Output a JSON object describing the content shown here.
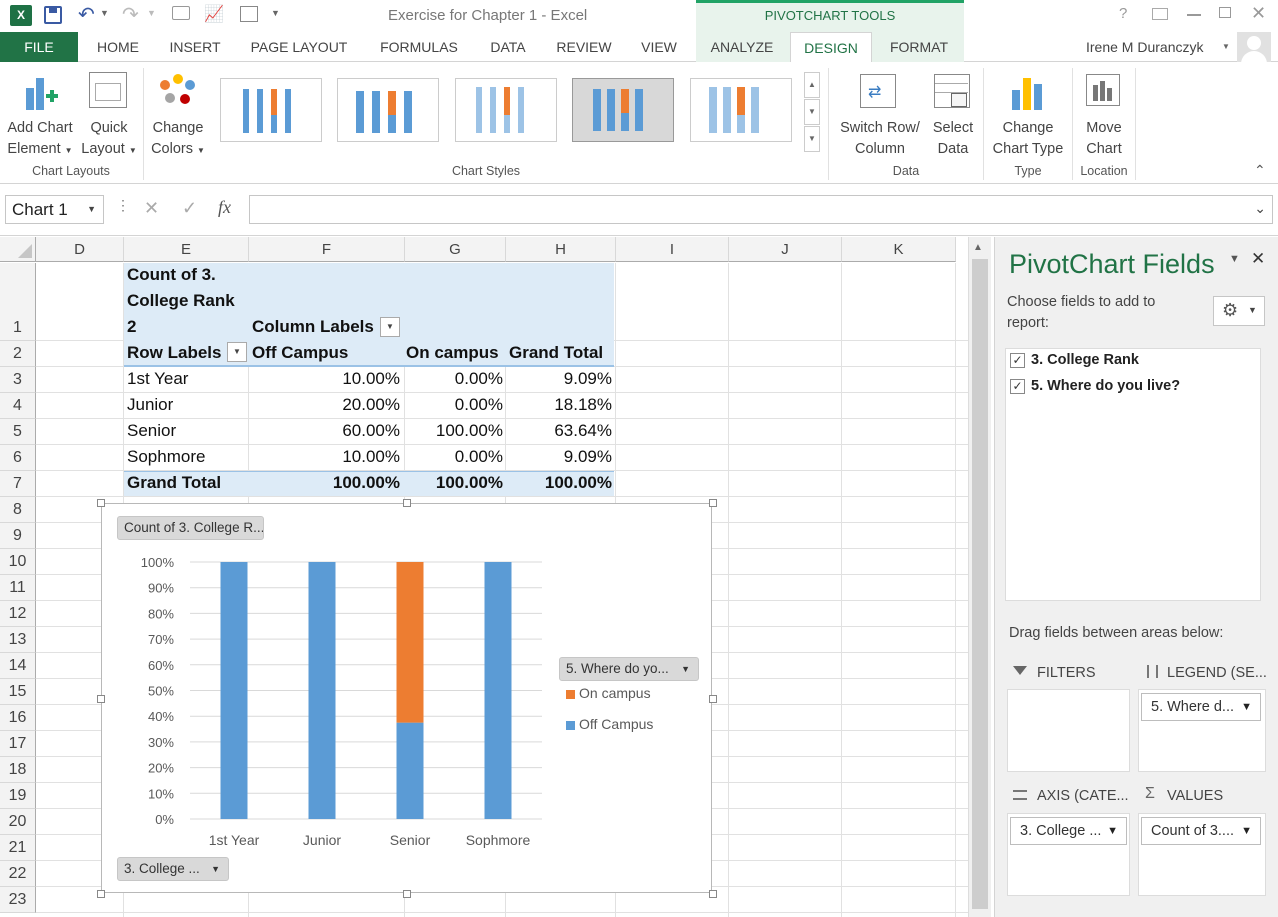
{
  "window": {
    "title": "Exercise for Chapter 1 - Excel",
    "context_tab_group": "PIVOTCHART TOOLS",
    "user": "Irene M Duranczyk",
    "help": "?"
  },
  "ribbon_tabs": [
    "FILE",
    "HOME",
    "INSERT",
    "PAGE LAYOUT",
    "FORMULAS",
    "DATA",
    "REVIEW",
    "VIEW",
    "ANALYZE",
    "DESIGN",
    "FORMAT"
  ],
  "active_tab": "DESIGN",
  "ribbon": {
    "add_chart_element": [
      "Add Chart",
      "Element"
    ],
    "quick_layout": [
      "Quick",
      "Layout"
    ],
    "group_chart_layouts": "Chart Layouts",
    "change_colors": [
      "Change",
      "Colors"
    ],
    "group_chart_styles": "Chart Styles",
    "switch_row_column": [
      "Switch Row/",
      "Column"
    ],
    "select_data": [
      "Select",
      "Data"
    ],
    "group_data": "Data",
    "change_chart_type": [
      "Change",
      "Chart Type"
    ],
    "group_type": "Type",
    "move_chart": [
      "Move",
      "Chart"
    ],
    "group_location": "Location"
  },
  "formula_bar": {
    "name_box": "Chart 1",
    "fx": "fx",
    "formula": ""
  },
  "sheet": {
    "columns": [
      "D",
      "E",
      "F",
      "G",
      "H",
      "I",
      "J",
      "K"
    ],
    "rows": [
      "1",
      "2",
      "3",
      "4",
      "5",
      "6",
      "7",
      "8",
      "9",
      "10",
      "11",
      "12",
      "13",
      "14",
      "15",
      "16",
      "17",
      "18",
      "19",
      "20",
      "21",
      "22",
      "23"
    ],
    "pivot_title": [
      "Count of 3.",
      "College Rank",
      "2"
    ],
    "column_labels": "Column Labels",
    "row_labels": "Row Labels",
    "headers": [
      "Off Campus",
      "On campus",
      "Grand Total"
    ],
    "data_rows": [
      {
        "label": "1st Year",
        "values": [
          "10.00%",
          "0.00%",
          "9.09%"
        ]
      },
      {
        "label": "Junior",
        "values": [
          "20.00%",
          "0.00%",
          "18.18%"
        ]
      },
      {
        "label": "Senior",
        "values": [
          "60.00%",
          "100.00%",
          "63.64%"
        ]
      },
      {
        "label": "Sophmore",
        "values": [
          "10.00%",
          "0.00%",
          "9.09%"
        ]
      }
    ],
    "grand_total": {
      "label": "Grand Total",
      "values": [
        "100.00%",
        "100.00%",
        "100.00%"
      ]
    }
  },
  "chart": {
    "value_button": "Count of 3. College R...",
    "legend_button": "5. Where do yo...",
    "axis_button": "3. College ...",
    "y_ticks": [
      "100%",
      "90%",
      "80%",
      "70%",
      "60%",
      "50%",
      "40%",
      "30%",
      "20%",
      "10%",
      "0%"
    ],
    "legend": [
      {
        "name": "On campus",
        "color": "#ed7d31"
      },
      {
        "name": "Off Campus",
        "color": "#5b9bd5"
      }
    ]
  },
  "chart_data": {
    "type": "bar",
    "stacked": true,
    "categories": [
      "1st Year",
      "Junior",
      "Senior",
      "Sophmore"
    ],
    "series": [
      {
        "name": "Off Campus",
        "values": [
          1.0,
          1.0,
          0.375,
          1.0
        ],
        "color": "#5b9bd5"
      },
      {
        "name": "On campus",
        "values": [
          0.0,
          0.0,
          0.625,
          0.0
        ],
        "color": "#ed7d31"
      }
    ],
    "ylim": [
      0,
      1
    ],
    "grid": true,
    "legend_position": "right"
  },
  "panel": {
    "title": "PivotChart Fields",
    "choose_text": [
      "Choose fields to add to",
      "report:"
    ],
    "fields": [
      {
        "label": "3. College Rank",
        "checked": true
      },
      {
        "label": "5. Where do you live?",
        "checked": true
      }
    ],
    "drag_text": "Drag fields between areas below:",
    "areas": {
      "filters": "FILTERS",
      "legend": "LEGEND (SE...",
      "axis": "AXIS (CATE...",
      "values": "VALUES"
    },
    "legend_field": "5. Where d...",
    "axis_field": "3. College ...",
    "values_field": "Count of 3...."
  }
}
